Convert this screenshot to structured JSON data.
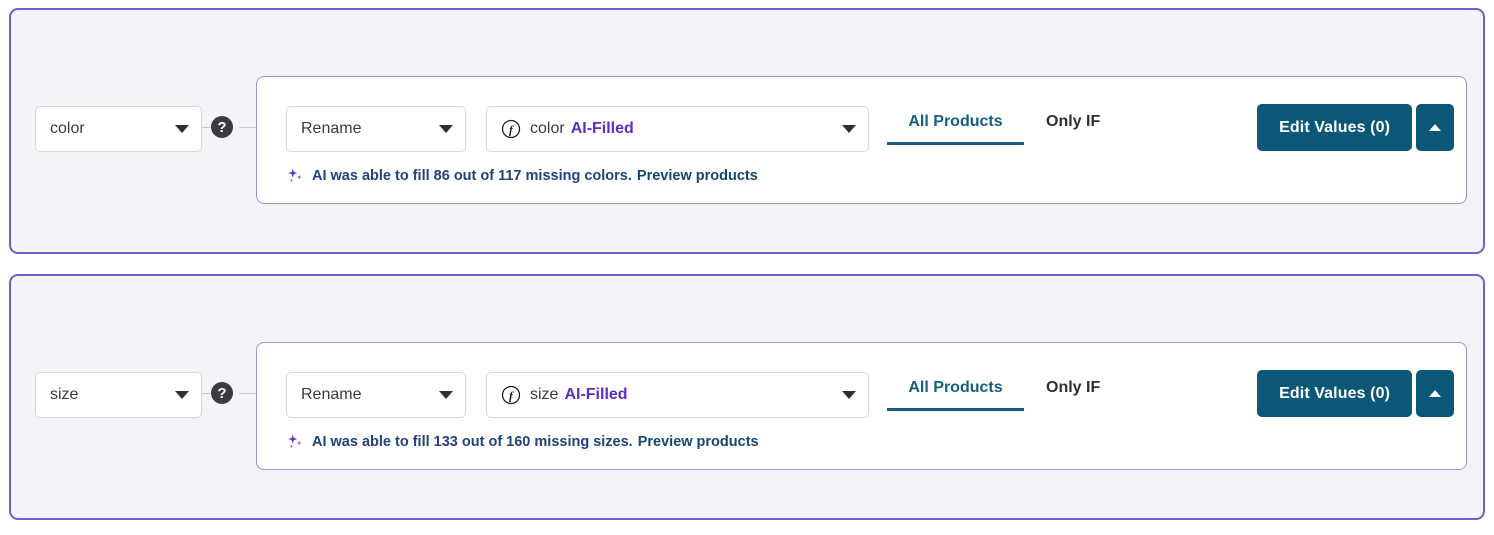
{
  "theme": {
    "card_bg": "#f4f3f8",
    "card_border": "#6c5fd0",
    "panel_border": "#a38ed6",
    "accent_button": "#0b5778",
    "active_tab": "#15607f",
    "ai_tag": "#5b2fc4",
    "ai_note_text": "#24417d"
  },
  "rules": [
    {
      "attribute": {
        "value": "color",
        "icon": "chevron-down-icon"
      },
      "help": {
        "label": "?",
        "icon": "help-icon"
      },
      "action": {
        "value": "Rename",
        "icon": "chevron-down-icon"
      },
      "source": {
        "icon": "function-icon",
        "name": "color",
        "tag": "AI-Filled",
        "caret": "chevron-down-icon"
      },
      "tabs": [
        {
          "label": "All Products",
          "active": true
        },
        {
          "label": "Only IF",
          "active": false
        }
      ],
      "edit_button": {
        "label": "Edit Values (0)",
        "caret_icon": "caret-up-icon"
      },
      "ai_note": {
        "icon": "sparkle-icon",
        "text": "AI was able to fill 86 out of 117 missing colors.",
        "link": "Preview products"
      }
    },
    {
      "attribute": {
        "value": "size",
        "icon": "chevron-down-icon"
      },
      "help": {
        "label": "?",
        "icon": "help-icon"
      },
      "action": {
        "value": "Rename",
        "icon": "chevron-down-icon"
      },
      "source": {
        "icon": "function-icon",
        "name": "size",
        "tag": "AI-Filled",
        "caret": "chevron-down-icon"
      },
      "tabs": [
        {
          "label": "All Products",
          "active": true
        },
        {
          "label": "Only IF",
          "active": false
        }
      ],
      "edit_button": {
        "label": "Edit Values (0)",
        "caret_icon": "caret-up-icon"
      },
      "ai_note": {
        "icon": "sparkle-icon",
        "text": "AI was able to fill 133 out of 160 missing sizes.",
        "link": "Preview products"
      }
    }
  ]
}
